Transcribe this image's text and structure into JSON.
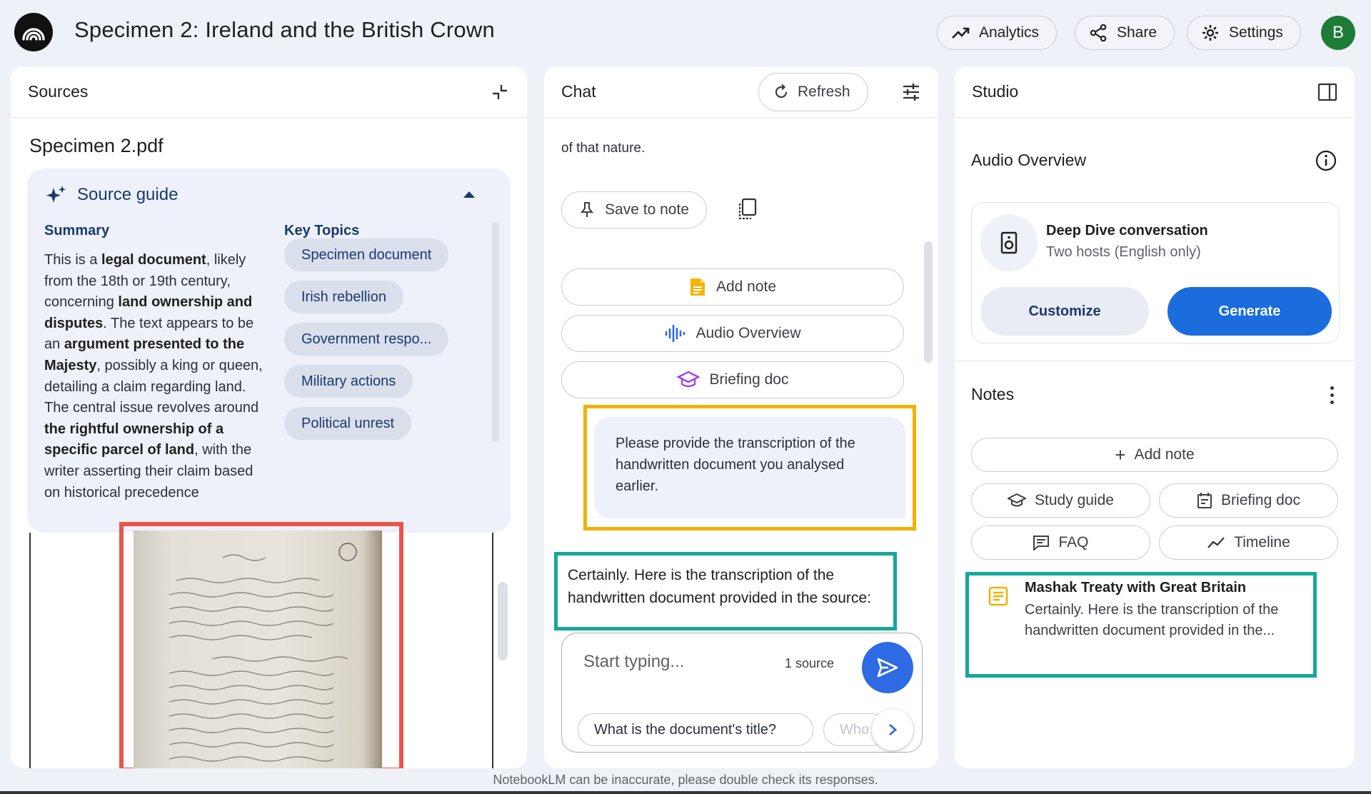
{
  "app": {
    "title": "Specimen 2: Ireland and the British Crown",
    "avatar_letter": "B",
    "colors": {
      "accent": "#2d6ae3",
      "highlight_red": "#e8554d",
      "highlight_yellow": "#f2b200",
      "highlight_teal": "#14a89a"
    }
  },
  "header": {
    "analytics_label": "Analytics",
    "share_label": "Share",
    "settings_label": "Settings"
  },
  "sources": {
    "title": "Sources",
    "file_name": "Specimen 2.pdf",
    "guide": {
      "title": "Source guide",
      "summary_label": "Summary",
      "topics_label": "Key Topics",
      "summary_parts": {
        "p1": "This is a ",
        "b1": "legal document",
        "p2": ", likely from the 18th or 19th century, concerning ",
        "b2": "land ownership and disputes",
        "p3": ". The text appears to be an ",
        "b3": "argument presented to the Majesty",
        "p4": ", possibly a king or queen, detailing a claim regarding land. The central issue revolves around ",
        "b4": "the rightful ownership of a specific parcel of land",
        "p5": ", with the writer asserting their claim based on historical precedence"
      },
      "topics": [
        "Specimen document",
        "Irish rebellion",
        "Government respo...",
        "Military actions",
        "Political unrest"
      ]
    }
  },
  "chat": {
    "title": "Chat",
    "refresh_label": "Refresh",
    "prev_text": "of that nature.",
    "save_to_note_label": "Save to note",
    "add_note_label": "Add note",
    "audio_overview_label": "Audio Overview",
    "briefing_doc_label": "Briefing doc",
    "user_message": "Please provide the transcription of the handwritten document you analysed earlier.",
    "answer_text": "Certainly. Here is the transcription of the handwritten document provided in the source:",
    "input_placeholder": "Start typing...",
    "source_count": "1 source",
    "suggestions": [
      "What is the document's title?",
      "Who"
    ]
  },
  "studio": {
    "title": "Studio",
    "audio_overview_title": "Audio Overview",
    "ao_card_title": "Deep Dive conversation",
    "ao_card_sub": "Two hosts (English only)",
    "customize_label": "Customize",
    "generate_label": "Generate",
    "notes_title": "Notes",
    "add_note_label": "Add note",
    "study_guide_label": "Study guide",
    "briefing_doc_label": "Briefing doc",
    "faq_label": "FAQ",
    "timeline_label": "Timeline",
    "note_title": "Mashak Treaty with Great Britain",
    "note_preview": "Certainly. Here is the transcription of the handwritten document provided in the..."
  },
  "footer": {
    "disclaimer": "NotebookLM can be inaccurate, please double check its responses."
  }
}
